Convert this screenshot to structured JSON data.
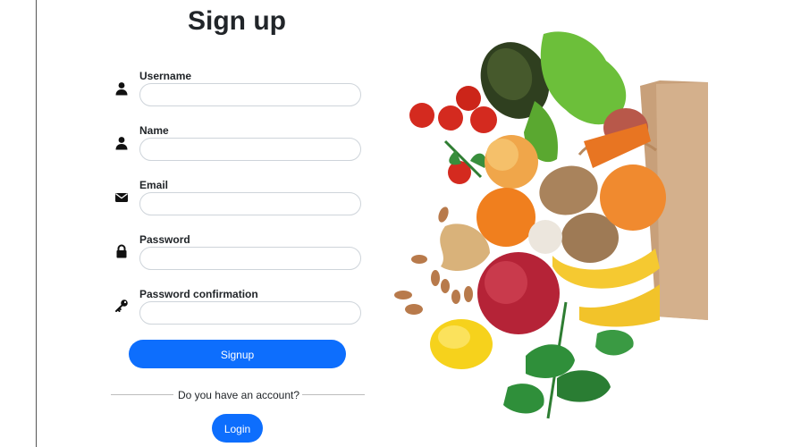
{
  "page": {
    "title": "Sign up"
  },
  "form": {
    "fields": [
      {
        "label": "Username",
        "icon": "user-icon",
        "value": "",
        "placeholder": ""
      },
      {
        "label": "Name",
        "icon": "user-icon",
        "value": "",
        "placeholder": ""
      },
      {
        "label": "Email",
        "icon": "envelope-icon",
        "value": "",
        "placeholder": ""
      },
      {
        "label": "Password",
        "icon": "lock-icon",
        "value": "",
        "placeholder": ""
      },
      {
        "label": "Password confirmation",
        "icon": "key-icon",
        "value": "",
        "placeholder": ""
      }
    ],
    "signup_label": "Signup"
  },
  "account": {
    "prompt": "Do you have an account?",
    "login_label": "Login"
  },
  "colors": {
    "primary": "#0d6efd",
    "text": "#212529",
    "input_border": "#ced4da"
  }
}
